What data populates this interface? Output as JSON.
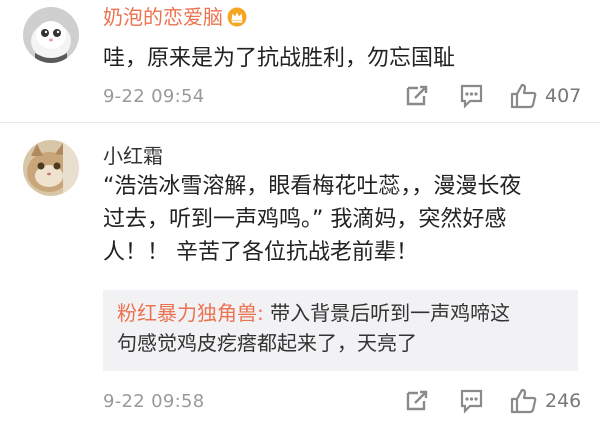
{
  "comments": [
    {
      "username": "奶泡的恋爱脑",
      "badge": "crown-icon",
      "text_lines": [
        "哇，原来是为了抗战胜利，勿忘国耻"
      ],
      "time": "9-22 09:54",
      "likes": "407"
    },
    {
      "username": "小红霜",
      "text_lines": [
        "“浩浩冰雪溶解，眼看梅花吐蕊，，漫漫长夜",
        "过去，听到一声鸡鸣。” 我滴妈，突然好感",
        "人！！ 辛苦了各位抗战老前辈！"
      ],
      "reply": {
        "name": "粉红暴力独角兽:",
        "line1": " 带入背景后听到一声鸡啼这",
        "line2": "句感觉鸡皮疙瘩都起来了，天亮了"
      },
      "time": "9-22 09:58",
      "likes": "246"
    }
  ],
  "colors": {
    "accent": "#eb7350",
    "meta": "#9a9a9a",
    "reply_bg": "#f2f2f5"
  }
}
